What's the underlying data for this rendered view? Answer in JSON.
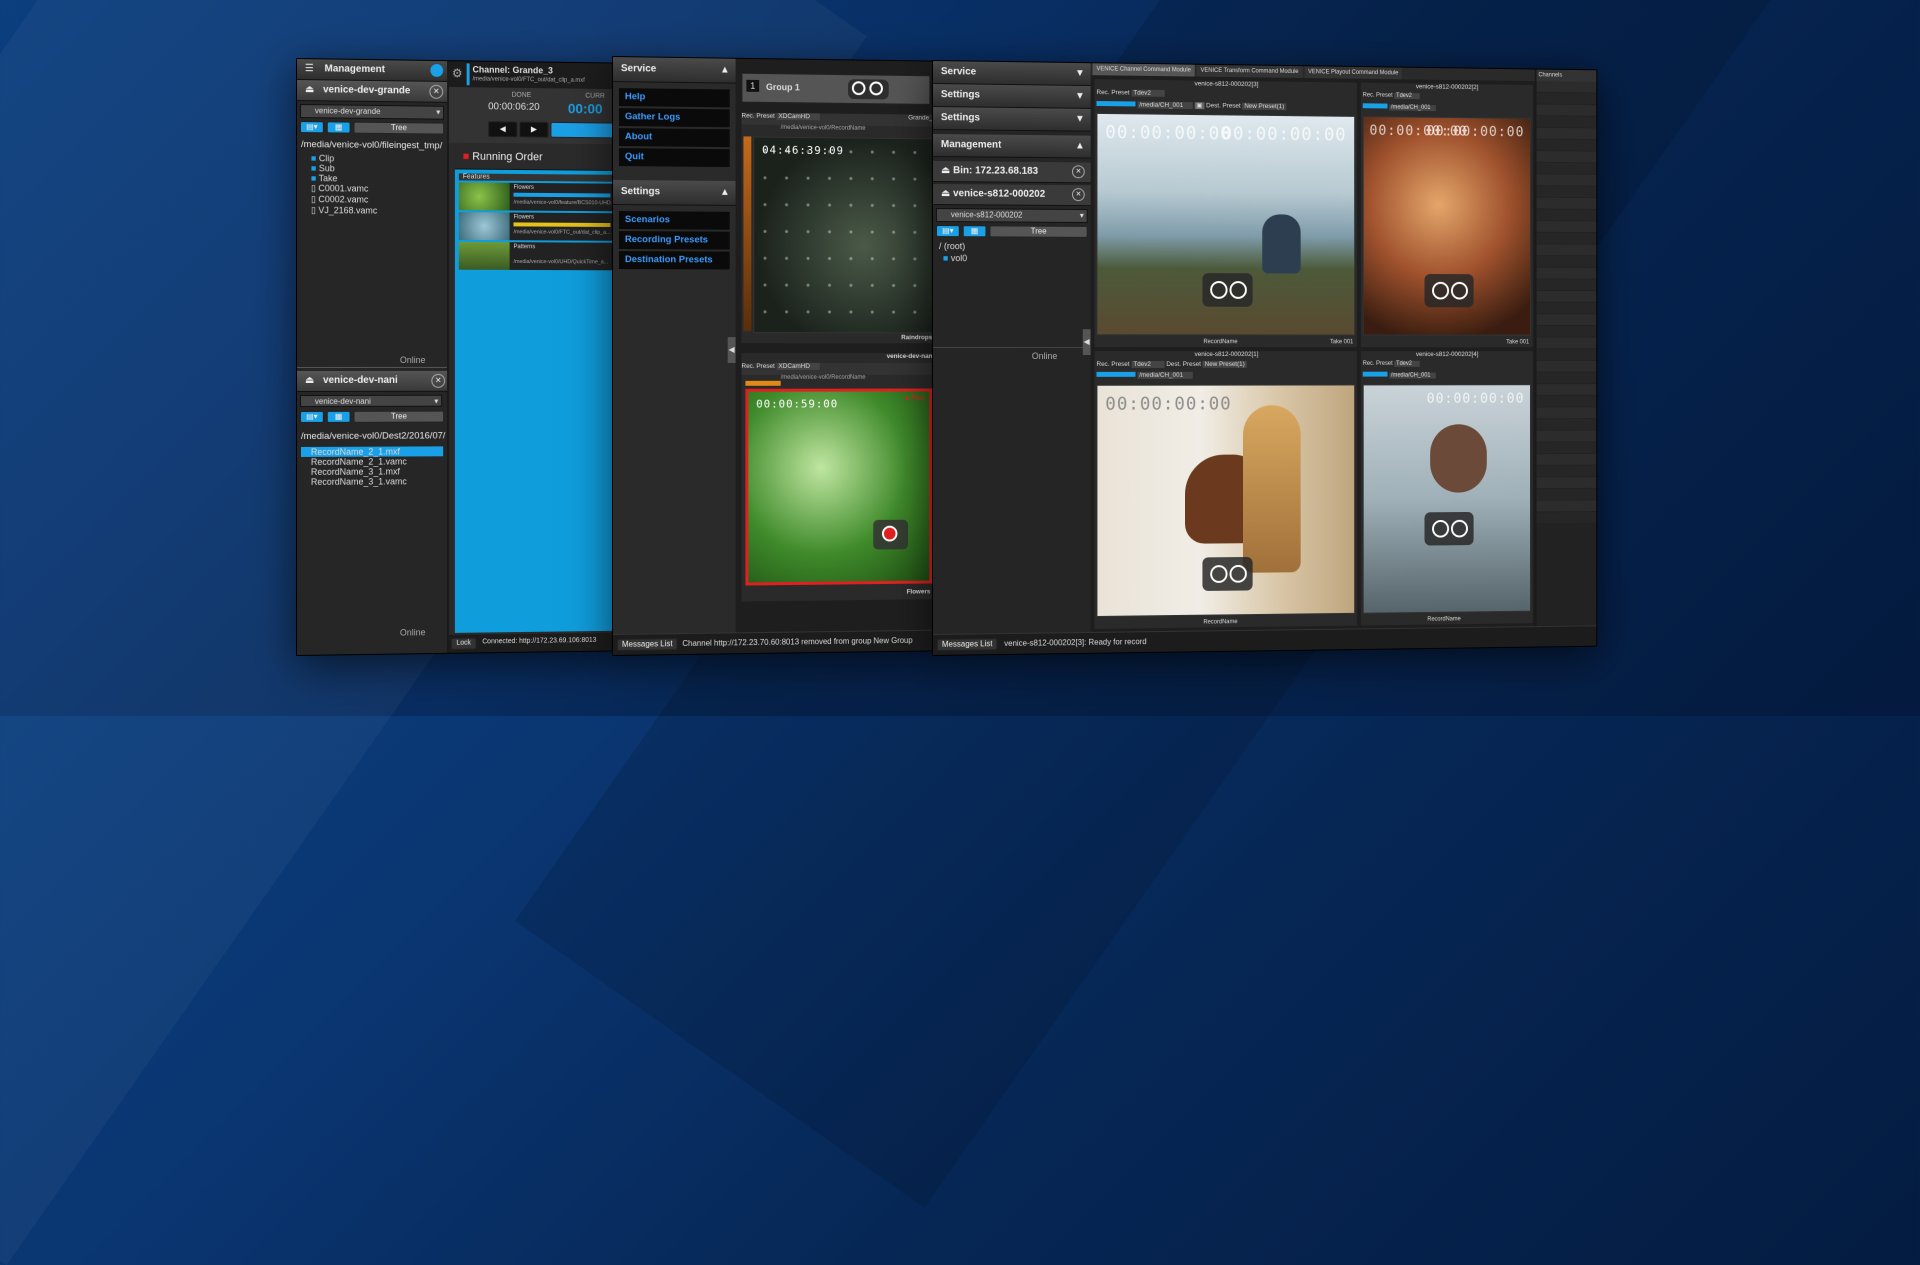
{
  "window1": {
    "management_title": "Management",
    "bin1_name": "venice-dev-grande",
    "bin1_select": "venice-dev-grande",
    "tree_label": "Tree",
    "bin1_path": "/media/venice-vol0/fileingest_tmp/",
    "bin1_items": [
      "Clip",
      "Sub",
      "Take",
      "C0001.vamc",
      "C0002.vamc",
      "VJ_2168.vamc"
    ],
    "status1": "Online",
    "bin2_name": "venice-dev-nani",
    "bin2_select": "venice-dev-nani",
    "bin2_path": "/media/venice-vol0/Dest2/2016/07/",
    "bin2_items": [
      "RecordName_2_1.mxf",
      "RecordName_2_1.vamc",
      "RecordName_3_1.mxf",
      "RecordName_3_1.vamc"
    ],
    "status2": "Online",
    "channel_title": "Channel: Grande_3",
    "channel_path": "/media/venice-vol0/FTC_out/dat_clip_a.mxf",
    "done_label": "DONE",
    "done_time": "00:00:06:20",
    "curr_label": "CURR",
    "curr_time": "00:00",
    "running_order_title": "Running Order",
    "features_label": "Features",
    "ro_items": [
      {
        "name": "Flowers",
        "path": "/media/venice-vol0/feature/BCS010-UHD..."
      },
      {
        "name": "Flowers",
        "path": "/media/venice-vol0/FTC_out/dat_clip_a..."
      },
      {
        "name": "Patterns",
        "path": "/media/venice-vol0/UHD/QuickTime_a..."
      }
    ],
    "lock_label": "Lock",
    "connected_text": "Connected: http://172.23.69.106:8013"
  },
  "window2": {
    "service_title": "Service",
    "service_items": [
      "Help",
      "Gather Logs",
      "About",
      "Quit"
    ],
    "settings_title": "Settings",
    "settings_items": [
      "Scenarios",
      "Recording Presets",
      "Destination Presets"
    ],
    "group_number": "1",
    "group_name": "Group 1",
    "rec_label": "Rec.",
    "preset_label": "Preset",
    "preset_value": "XDCamHD",
    "ch1_name": "Grande_3",
    "ch1_path": "/media/venice-vol0/RecordName",
    "ch1_time": "04:46:39:09",
    "ch1_footer": "Raindrops",
    "ch2_name": "venice-dev-nani",
    "ch2_path": "/media/venice-vol0/RecordName",
    "ch2_time": "00:00:59:00",
    "ch2_rec": "● Rec",
    "ch2_footer": "Flowers",
    "messages_label": "Messages List",
    "message_text": "Channel http://172.23.70.60:8013 removed from group New Group"
  },
  "window3": {
    "service_title": "Service",
    "settings_title_1": "Settings",
    "settings_title_2": "Settings",
    "management_title": "Management",
    "bin_ip": "Bin: 172.23.68.183",
    "bin_host": "venice-s812-000202",
    "bin_select": "venice-s812-000202",
    "tree_label": "Tree",
    "tree_root": "/ (root)",
    "tree_child": "vol0",
    "status": "Online",
    "tabs": [
      "VENICE Channel Command Module",
      "VENICE Transform Command Module",
      "VENICE Playout Command Module"
    ],
    "cell_header_a": "venice-s812-000202[3]",
    "cell_header_b": "venice-s812-000202[2]",
    "cell_header_c": "venice-s812-000202[1]",
    "cell_header_d": "venice-s812-000202[4]",
    "rec_label": "Rec.",
    "preset_label": "Preset",
    "preset_value": "Tdev2",
    "cell_path": "/media/CH_001",
    "dest_preset_label": "Dest. Preset",
    "dest_preset_value": "New Preset(1)",
    "timecode": "00:00:00:00",
    "record_name": "RecordName",
    "take_label": "Take 001",
    "channels_title": "Channels",
    "messages_label": "Messages List",
    "message_text": "venice-s812-000202[3]: Ready for record"
  },
  "colors": {
    "accent_blue": "#1aa0e6",
    "link_blue": "#3d9bff",
    "record_red": "#e02020",
    "bg_dark": "#1a1a1a"
  }
}
